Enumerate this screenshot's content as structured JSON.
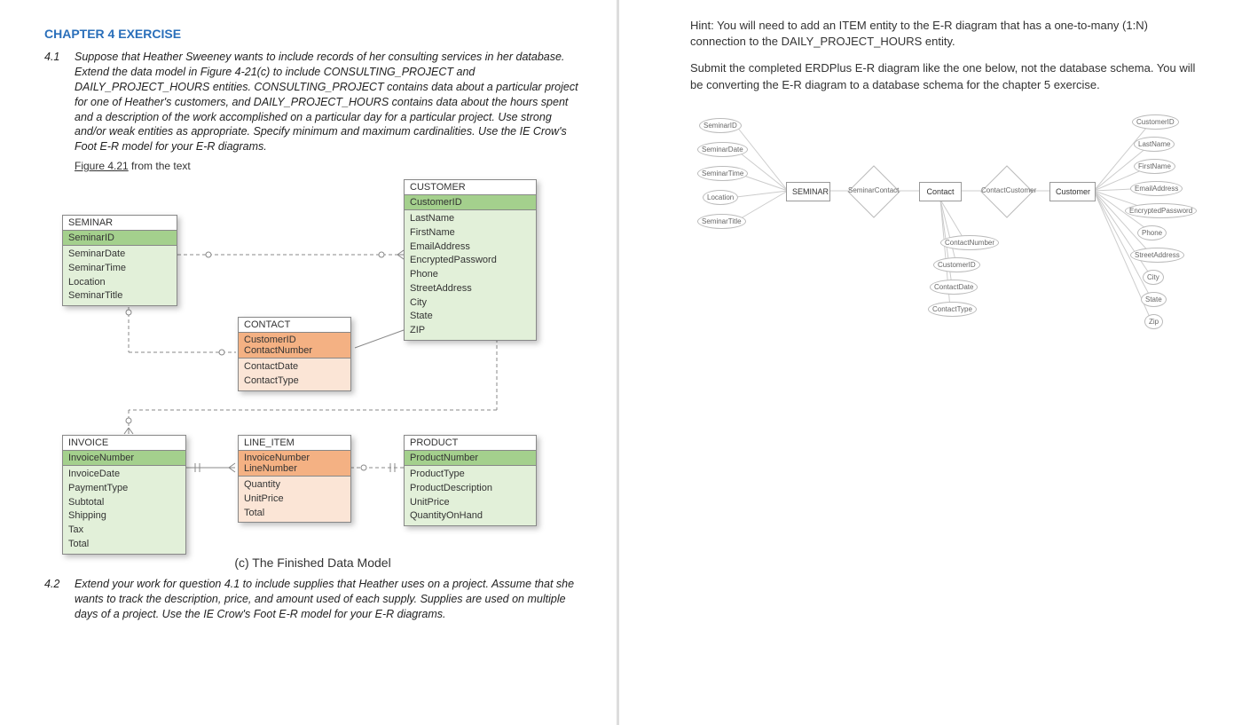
{
  "left": {
    "chapter_title": "CHAPTER 4 EXERCISE",
    "ex_4_1_num": "4.1",
    "ex_4_1_body": "Suppose that Heather Sweeney wants to include records of her consulting services in her database.  Extend the data model in Figure 4-21(c) to include CONSULTING_PROJECT and DAILY_PROJECT_HOURS entities. CONSULTING_PROJECT contains data about a particular project for one of Heather's customers, and DAILY_PROJECT_HOURS contains data about the hours spent and a description of the work accomplished on a particular day for a particular project. Use strong and/or weak entities as appropriate.  Specify minimum and maximum cardinalities.  Use the IE Crow's Foot E-R model for your E-R diagrams.",
    "figure_caption_prefix": "Figure 4.21",
    "figure_caption_suffix": " from the text",
    "entities": {
      "seminar": {
        "name": "SEMINAR",
        "key": "SeminarID",
        "attrs": [
          "SeminarDate",
          "SeminarTime",
          "Location",
          "SeminarTitle"
        ]
      },
      "customer": {
        "name": "CUSTOMER",
        "key": "CustomerID",
        "attrs": [
          "LastName",
          "FirstName",
          "EmailAddress",
          "EncryptedPassword",
          "Phone",
          "StreetAddress",
          "City",
          "State",
          "ZIP"
        ]
      },
      "contact": {
        "name": "CONTACT",
        "key1": "CustomerID",
        "key2": "ContactNumber",
        "attrs": [
          "ContactDate",
          "ContactType"
        ]
      },
      "invoice": {
        "name": "INVOICE",
        "key": "InvoiceNumber",
        "attrs": [
          "InvoiceDate",
          "PaymentType",
          "Subtotal",
          "Shipping",
          "Tax",
          "Total"
        ]
      },
      "line_item": {
        "name": "LINE_ITEM",
        "key1": "InvoiceNumber",
        "key2": "LineNumber",
        "attrs": [
          "Quantity",
          "UnitPrice",
          "Total"
        ]
      },
      "product": {
        "name": "PRODUCT",
        "key": "ProductNumber",
        "attrs": [
          "ProductType",
          "ProductDescription",
          "UnitPrice",
          "QuantityOnHand"
        ]
      }
    },
    "model_caption": "(c) The Finished Data Model",
    "ex_4_2_num": "4.2",
    "ex_4_2_body": "Extend your work for question 4.1 to include supplies that Heather uses on a project. Assume that she wants to track the description, price, and amount used of each supply. Supplies are used on multiple days of a project. Use the IE Crow's Foot E-R model for your E-R diagrams."
  },
  "right": {
    "hint": "Hint: You will need to add an ITEM entity to the E-R diagram that has a one-to-many (1:N) connection to the DAILY_PROJECT_HOURS entity.",
    "submit": "Submit the completed ERDPlus E-R diagram like the one below, not the database schema.  You will be converting the E-R diagram to a database schema for the chapter 5 exercise.",
    "er": {
      "seminar_attrs": [
        "SeminarID",
        "SeminarDate",
        "SeminarTime",
        "Location",
        "SeminarTitle"
      ],
      "customer_attrs": [
        "CustomerID",
        "LastName",
        "FirstName",
        "EmailAddress",
        "EncryptedPassword",
        "Phone",
        "StreetAddress",
        "City",
        "State",
        "Zip"
      ],
      "contact_attrs": [
        "ContactNumber",
        "CustomerID",
        "ContactDate",
        "ContactType"
      ],
      "seminar_label": "SEMINAR",
      "contact_label": "Contact",
      "customer_label": "Customer",
      "rel1": "SeminarContact",
      "rel2": "ContactCustomer"
    }
  }
}
